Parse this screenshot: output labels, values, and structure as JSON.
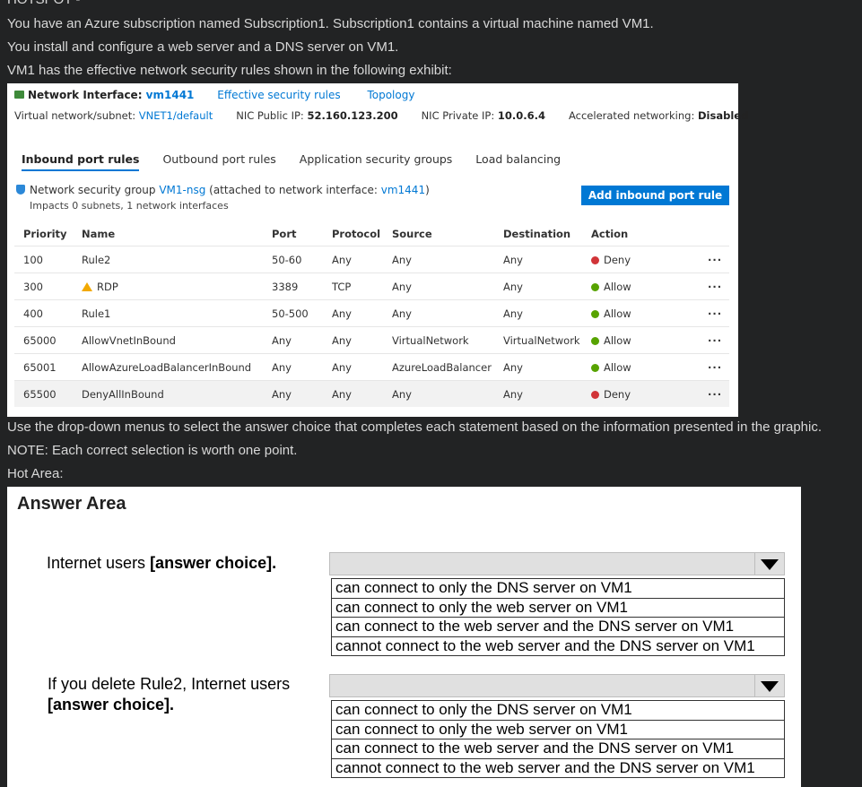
{
  "question": {
    "heading": "HOTSPOT -",
    "lines": [
      "You have an Azure subscription named Subscription1. Subscription1 contains a virtual machine named VM1.",
      "You install and configure a web server and a DNS server on VM1.",
      "VM1 has the effective network security rules shown in the following exhibit:"
    ],
    "after": [
      "Use the drop-down menus to select the answer choice that completes each statement based on the information presented in the graphic.",
      "NOTE: Each correct selection is worth one point.",
      "Hot Area:"
    ]
  },
  "exhibit": {
    "title_prefix": "Network Interface: ",
    "title_name": "vm1441",
    "link_effective": "Effective security rules",
    "link_topology": "Topology",
    "vnet_label": "Virtual network/subnet: ",
    "vnet_value": "VNET1/default",
    "public_ip_label": "NIC Public IP: ",
    "public_ip_value": "52.160.123.200",
    "private_ip_label": "NIC Private IP: ",
    "private_ip_value": "10.0.6.4",
    "accel_label": "Accelerated networking: ",
    "accel_value": "Disabled",
    "tabs": [
      "Inbound port rules",
      "Outbound port rules",
      "Application security groups",
      "Load balancing"
    ],
    "nsg_prefix": "Network security group ",
    "nsg_name": "VM1-nsg",
    "nsg_mid": " (attached to network interface: ",
    "nsg_nic": "vm1441",
    "nsg_suffix": ")",
    "nsg_sub": "Impacts 0 subnets, 1 network interfaces",
    "add_button": "Add inbound port rule",
    "columns": [
      "Priority",
      "Name",
      "Port",
      "Protocol",
      "Source",
      "Destination",
      "Action"
    ],
    "more": "···",
    "rows": [
      {
        "priority": "100",
        "name": "Rule2",
        "port": "50-60",
        "protocol": "Any",
        "source": "Any",
        "destination": "Any",
        "action": "Deny"
      },
      {
        "priority": "300",
        "name": "RDP",
        "port": "3389",
        "protocol": "TCP",
        "source": "Any",
        "destination": "Any",
        "action": "Allow"
      },
      {
        "priority": "400",
        "name": "Rule1",
        "port": "50-500",
        "protocol": "Any",
        "source": "Any",
        "destination": "Any",
        "action": "Allow"
      },
      {
        "priority": "65000",
        "name": "AllowVnetInBound",
        "port": "Any",
        "protocol": "Any",
        "source": "VirtualNetwork",
        "destination": "VirtualNetwork",
        "action": "Allow"
      },
      {
        "priority": "65001",
        "name": "AllowAzureLoadBalancerInBound",
        "port": "Any",
        "protocol": "Any",
        "source": "AzureLoadBalancer",
        "destination": "Any",
        "action": "Allow"
      },
      {
        "priority": "65500",
        "name": "DenyAllInBound",
        "port": "Any",
        "protocol": "Any",
        "source": "Any",
        "destination": "Any",
        "action": "Deny"
      }
    ]
  },
  "answer_area": {
    "title": "Answer Area",
    "q1_text": "Internet users ",
    "q1_bold": "[answer choice].",
    "q2_text": "If you delete Rule2, Internet users",
    "q2_bold": "[answer choice].",
    "options": [
      "can connect to only the DNS server on VM1",
      "can connect to only the web server on VM1",
      "can connect to the web server and the DNS server on VM1",
      "cannot connect to the web server and the DNS server on VM1"
    ]
  },
  "colors": {
    "accent": "#0078d4",
    "deny": "#d13438",
    "allow": "#57a300",
    "warning": "#f2a900"
  }
}
